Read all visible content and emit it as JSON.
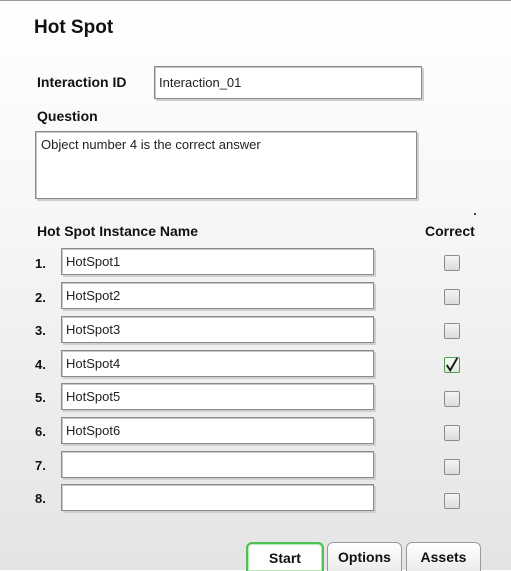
{
  "panel": {
    "title": "Hot Spot"
  },
  "interaction": {
    "label": "Interaction ID",
    "value": "Interaction_01"
  },
  "question": {
    "label": "Question",
    "value": "Object number 4 is the correct answer"
  },
  "hotspots": {
    "name_header": "Hot Spot Instance Name",
    "correct_header": "Correct",
    "rows": [
      {
        "number": "1.",
        "name": "HotSpot1",
        "correct": false
      },
      {
        "number": "2.",
        "name": "HotSpot2",
        "correct": false
      },
      {
        "number": "3.",
        "name": "HotSpot3",
        "correct": false
      },
      {
        "number": "4.",
        "name": "HotSpot4",
        "correct": true
      },
      {
        "number": "5.",
        "name": "HotSpot5",
        "correct": false
      },
      {
        "number": "6.",
        "name": "HotSpot6",
        "correct": false
      },
      {
        "number": "7.",
        "name": "",
        "correct": false
      },
      {
        "number": "8.",
        "name": "",
        "correct": false
      }
    ]
  },
  "tabs": [
    {
      "label": "Start",
      "active": true
    },
    {
      "label": "Options",
      "active": false
    },
    {
      "label": "Assets",
      "active": false
    }
  ],
  "colors": {
    "active_tab_border": "#4ec04e",
    "checkmark": "#1a1a1a"
  },
  "icons": {
    "checked": "checkmark-icon"
  }
}
